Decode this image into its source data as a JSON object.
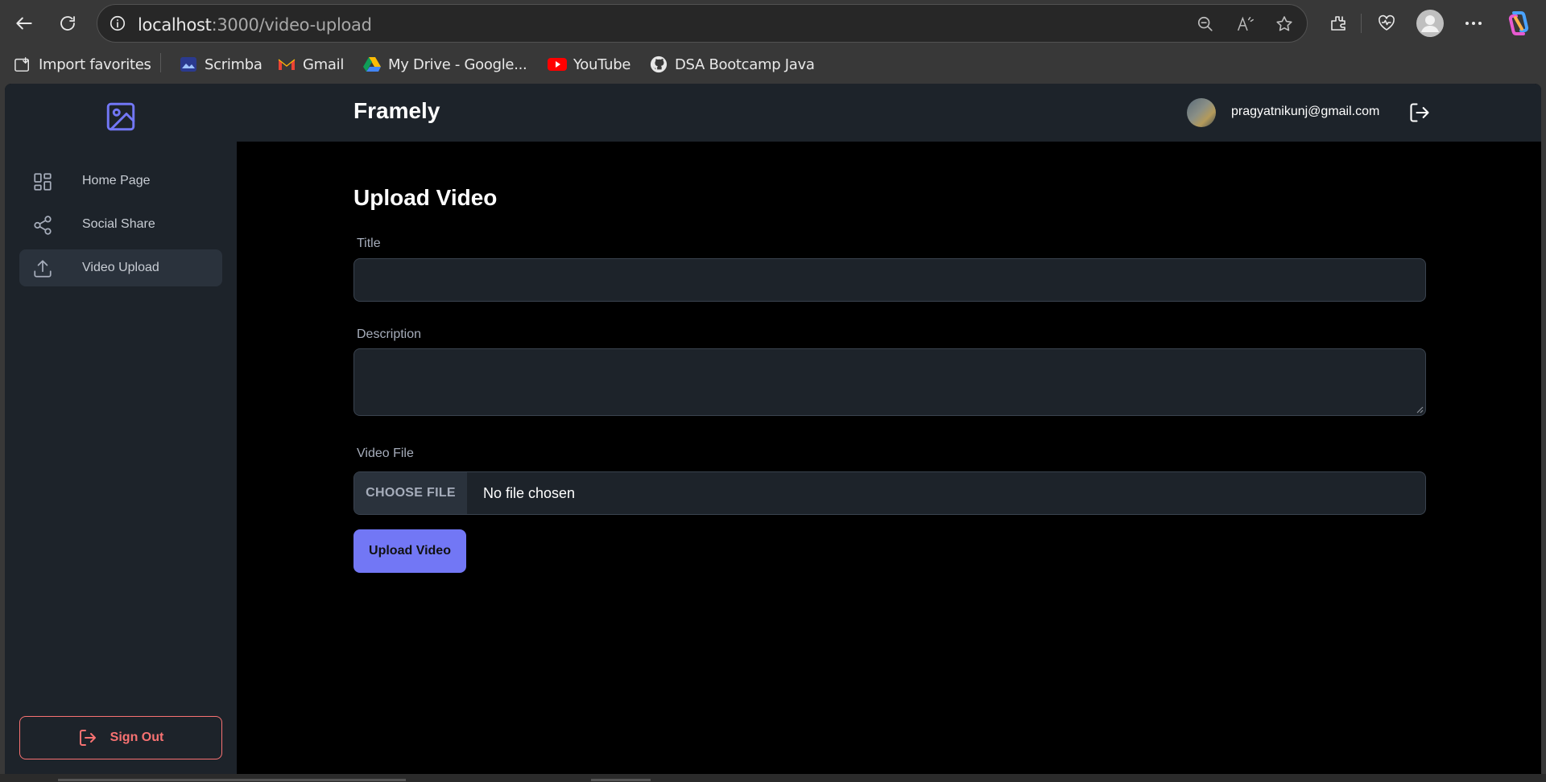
{
  "browser": {
    "url_host": "localhost",
    "url_rest": ":3000/video-upload",
    "bookmarks": [
      {
        "label": "Import favorites",
        "icon": "import-icon"
      },
      {
        "label": "Scrimba",
        "icon": "scrimba-icon"
      },
      {
        "label": "Gmail",
        "icon": "gmail-icon"
      },
      {
        "label": "My Drive - Google...",
        "icon": "google-drive-icon"
      },
      {
        "label": "YouTube",
        "icon": "youtube-icon"
      },
      {
        "label": "DSA Bootcamp Java",
        "icon": "github-icon"
      }
    ]
  },
  "header": {
    "brand": "Framely",
    "user_email": "pragyatnikunj@gmail.com"
  },
  "sidebar": {
    "items": [
      {
        "label": "Home Page",
        "icon": "grid-icon",
        "active": false
      },
      {
        "label": "Social Share",
        "icon": "share-icon",
        "active": false
      },
      {
        "label": "Video Upload",
        "icon": "upload-icon",
        "active": true
      }
    ],
    "sign_out_label": "Sign Out"
  },
  "form": {
    "heading": "Upload Video",
    "title_label": "Title",
    "title_value": "",
    "description_label": "Description",
    "description_value": "",
    "file_label": "Video File",
    "choose_file_label": "CHOOSE FILE",
    "no_file_text": "No file chosen",
    "submit_label": "Upload Video"
  },
  "colors": {
    "accent": "#7277f5",
    "danger": "#f87272",
    "panel": "#1d232a",
    "background": "#000000"
  }
}
